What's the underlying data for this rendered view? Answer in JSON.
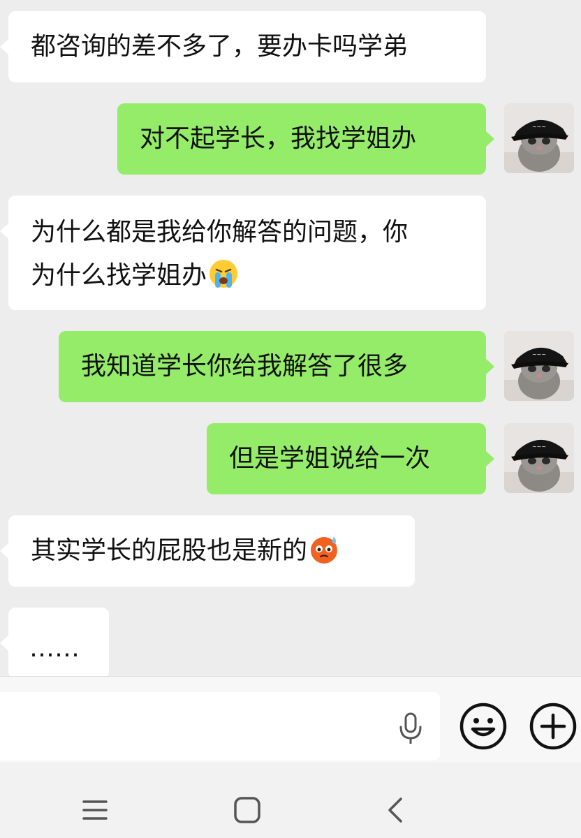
{
  "messages": [
    {
      "side": "in",
      "lines": [
        "都咨询的差不多了，要办卡吗学弟"
      ]
    },
    {
      "side": "out",
      "lines": [
        "对不起学长，我找学姐办"
      ]
    },
    {
      "side": "in",
      "lines": [
        "为什么都是我给你解答的问题，你",
        "为什么找学姐办"
      ],
      "emoji": "loudly-crying-emoji"
    },
    {
      "side": "out",
      "lines": [
        "我知道学长你给我解答了很多"
      ]
    },
    {
      "side": "out",
      "lines": [
        "但是学姐说给一次"
      ]
    },
    {
      "side": "in",
      "lines": [
        "其实学长的屁股也是新的"
      ],
      "emoji": "flushed-sweat-emoji"
    },
    {
      "side": "in",
      "lines": [
        "……"
      ]
    }
  ],
  "avatar": {
    "icon": "kitten-with-black-cap-avatar"
  },
  "input": {
    "value": "",
    "placeholder": ""
  },
  "icons": {
    "mic": "microphone-icon",
    "emoji": "smiley-icon",
    "plus": "plus-icon",
    "nav_menu": "menu-icon",
    "nav_home": "square-home-icon",
    "nav_back": "back-chevron-icon"
  },
  "colors": {
    "background": "#ededed",
    "incoming_bubble": "#ffffff",
    "outgoing_bubble": "#95ec69"
  }
}
